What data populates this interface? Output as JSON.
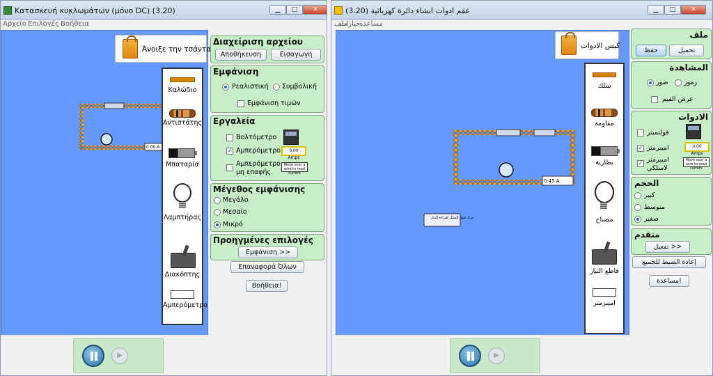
{
  "left": {
    "title": "Κατασκευή κυκλωμάτων (μόνο DC) (3.20)",
    "window_buttons": {
      "minimize": "▁",
      "maximize": "□",
      "close": "✕"
    },
    "menu": [
      "Αρχείο",
      "Επιλογές",
      "Βοήθεια"
    ],
    "bag_button": "Άνοιξε την τσάντα",
    "toolbox": {
      "wire": "Καλώδιο",
      "resistor": "Αντιστάτης",
      "battery": "Μπαταρία",
      "bulb": "Λαμπτήρας",
      "switch": "Διακόπτης",
      "ammeter": "Αμπερόμετρο"
    },
    "circuit_ammeter": "0.00 A",
    "panels": {
      "file": {
        "title": "Διαχείριση αρχείου",
        "save": "Αποθήκευση",
        "load": "Εισαγωγή"
      },
      "view": {
        "title": "Εμφάνιση",
        "lifelike": "Ρεαλιστική",
        "schematic": "Συμβολική",
        "show_values": "Εμφάνιση τιμών"
      },
      "tools": {
        "title": "Εργαλεία",
        "voltmeter": "Βολτόμετρο",
        "ammeter": "Αμπερόμετρο",
        "noncontact1": "Αμπερόμετρο",
        "noncontact2": "μη επαφής",
        "amps": "0.00 Amps",
        "ncam": "Move over a wire to read current"
      },
      "size": {
        "title": "Μέγεθος εμφάνισης",
        "large": "Μεγάλο",
        "medium": "Μεσαίο",
        "small": "Μικρό"
      },
      "advanced": {
        "title": "Προηγμένες επιλογές",
        "show": "Εμφάνιση >>"
      }
    },
    "reset": "Επαναφορά Όλων",
    "help": "Βοήθεια!"
  },
  "right": {
    "title": "(عقم ادوات انشاء دائرة كهربائية (3.20",
    "window_buttons": {
      "minimize": "▁",
      "maximize": "□",
      "close": "✕"
    },
    "menu": [
      "مساعدة",
      "خيارات",
      "ملف"
    ],
    "bag_button": "كيس الادوات",
    "toolbox": {
      "wire": "سلك",
      "resistor": "مقاومة",
      "battery": "بطارية",
      "bulb": "مصباح",
      "switch": "قاطع التيار",
      "ammeter": "اميبرمتر"
    },
    "circuit_ammeter": "0.45 A",
    "ncam_canvas": "حرك فوق السلك لقراءة التيار",
    "panels": {
      "file": {
        "title": "ملف",
        "save": "حفظ",
        "load": "تحميل"
      },
      "view": {
        "title": "المشاهدة",
        "lifelike": "صور",
        "schematic": "رموز",
        "show_values": "عرض القيم"
      },
      "tools": {
        "title": "الادوات",
        "voltmeter": "فولتميتر",
        "ammeter": "اميبرمتر",
        "noncontact1": "اميبرمتر",
        "noncontact2": "لاسلكي",
        "amps": "0.00 Amps",
        "ncam": "Move over a wire to read current"
      },
      "size": {
        "title": "الحجم",
        "large": "كبير",
        "medium": "متوسط",
        "small": "صغير"
      },
      "advanced": {
        "title": "متقدم",
        "show": "تفعيل >>"
      }
    },
    "reset": "إعادة الضبط للجميع",
    "help": "مساعدة!"
  },
  "colors": {
    "canvas": "#6699ff",
    "panel": "#c8eec8",
    "wire": "#d88400"
  }
}
